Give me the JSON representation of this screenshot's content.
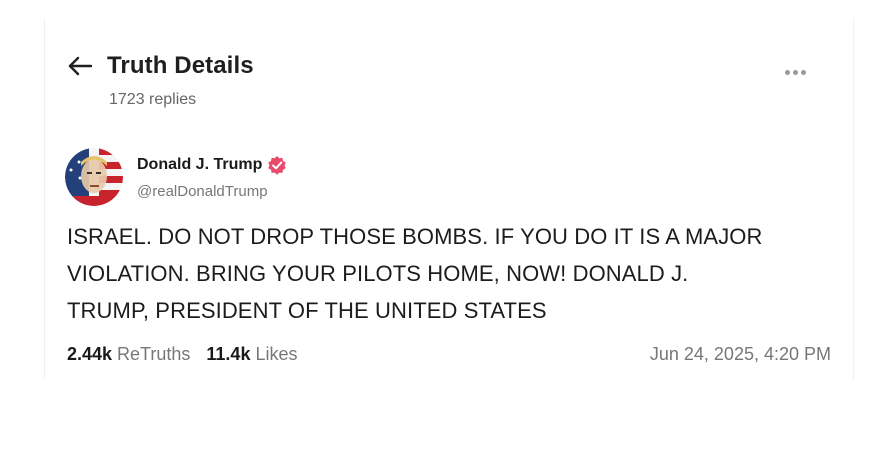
{
  "header": {
    "title": "Truth Details",
    "replies": "1723 replies",
    "back_icon": "arrow-left-icon",
    "more_icon": "ellipsis-icon"
  },
  "post": {
    "author": {
      "name": "Donald J. Trump",
      "handle": "@realDonaldTrump",
      "verified_icon": "verified-badge-icon",
      "verified_color": "#e94b6b"
    },
    "body_lines": [
      "ISRAEL. DO NOT DROP THOSE BOMBS. IF YOU DO IT IS A MAJOR",
      "VIOLATION. BRING YOUR PILOTS HOME, NOW!  DONALD J.",
      "TRUMP, PRESIDENT OF THE UNITED STATES"
    ],
    "stats": {
      "retruths_count": "2.44k",
      "retruths_label": "ReTruths",
      "likes_count": "11.4k",
      "likes_label": "Likes"
    },
    "timestamp": "Jun 24, 2025, 4:20 PM"
  }
}
